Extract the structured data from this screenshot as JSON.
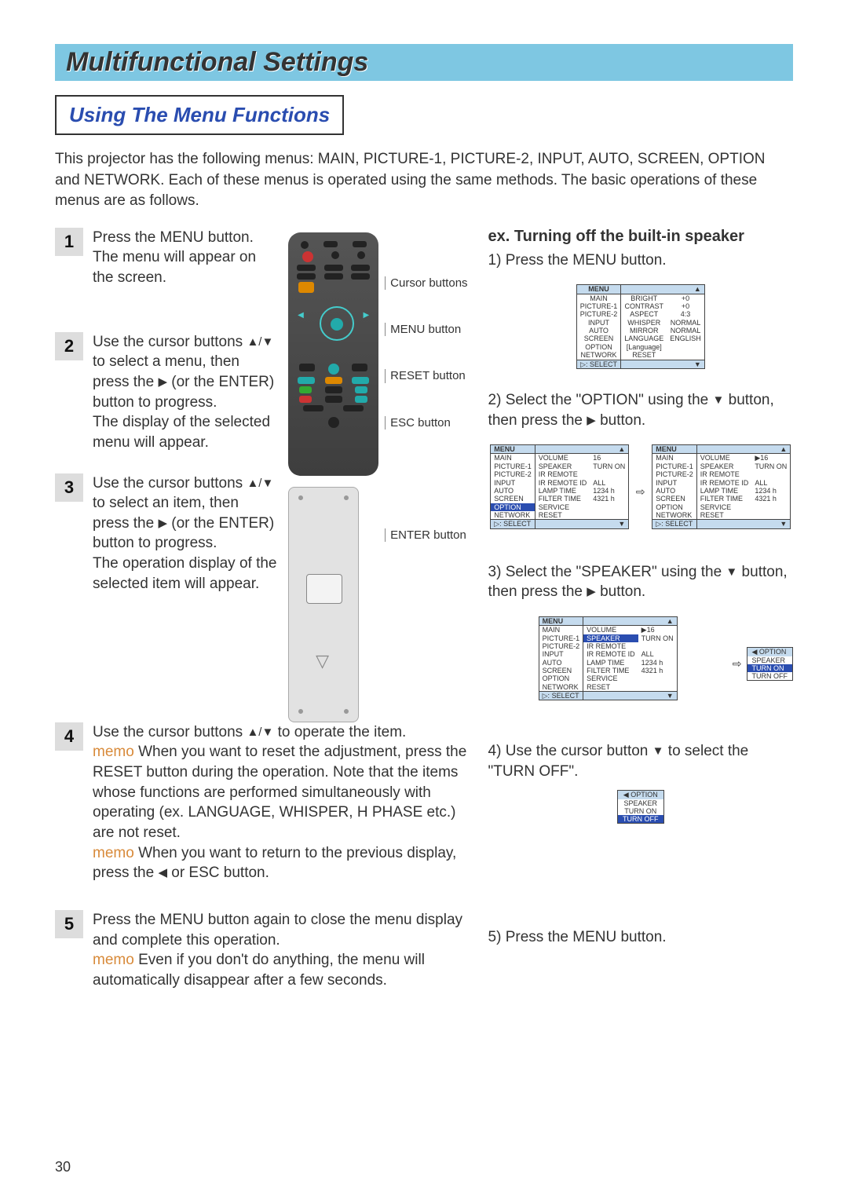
{
  "title": "Multifunctional Settings",
  "subtitle": "Using The Menu Functions",
  "intro": "This projector has the following menus: MAIN, PICTURE-1, PICTURE-2, INPUT, AUTO, SCREEN, OPTION and NETWORK. Each of these menus is operated using the same methods. The basic operations of these menus are as follows.",
  "steps": {
    "s1": {
      "num": "1",
      "text": "Press the MENU button. The menu will appear on the screen."
    },
    "s2": {
      "num": "2",
      "text_a": "Use the cursor buttons ",
      "text_b": " to select a menu, then press the ",
      "text_c": " (or the ENTER) button to progress.",
      "text_d": "The display of the selected menu will appear."
    },
    "s3": {
      "num": "3",
      "text_a": "Use the cursor buttons ",
      "text_b": " to select an item, then press the ",
      "text_c": " (or the ENTER) button to progress.",
      "text_d": "The operation display of the selected item will appear."
    },
    "s4": {
      "num": "4",
      "heading_a": "Use the cursor buttons ",
      "heading_b": " to operate the item.",
      "memo1": "memo",
      "note1": " When you want to reset the adjustment, press the RESET button during the operation. Note that the items whose functions are performed simultaneously with operating (ex. LANGUAGE, WHISPER, H PHASE etc.) are not reset.",
      "memo2": "memo",
      "note2_a": " When you want to return to the previous display, press the ",
      "note2_b": " or ESC button."
    },
    "s5": {
      "num": "5",
      "text": "Press the MENU button again to close the menu display and complete this operation.",
      "memo": "memo",
      "note": " Even if you don't do anything, the menu will automatically disappear after a few seconds."
    }
  },
  "remote_labels": {
    "cursor": "Cursor buttons",
    "menu": "MENU button",
    "reset": "RESET button",
    "esc": "ESC button",
    "enter": "ENTER button"
  },
  "example": {
    "title": "ex. Turning off the built-in speaker",
    "s1": "1) Press the MENU button.",
    "s2_a": "2) Select the \"OPTION\" using the ",
    "s2_b": " button, then press the ",
    "s2_c": " button.",
    "s3_a": "3) Select the \"SPEAKER\" using the ",
    "s3_b": " button, then press the ",
    "s3_c": " button.",
    "s4_a": "4) Use the cursor button ",
    "s4_b": " to select the \"TURN OFF\".",
    "s5": "5) Press the MENU button."
  },
  "osd_main": {
    "header": "MENU",
    "rows": [
      [
        "MAIN",
        "BRIGHT",
        "+0"
      ],
      [
        "PICTURE-1",
        "CONTRAST",
        "+0"
      ],
      [
        "PICTURE-2",
        "ASPECT",
        "4:3"
      ],
      [
        "INPUT",
        "WHISPER",
        "NORMAL"
      ],
      [
        "AUTO",
        "MIRROR",
        "NORMAL"
      ],
      [
        "SCREEN",
        "LANGUAGE",
        "ENGLISH"
      ],
      [
        "OPTION",
        "[Language]",
        ""
      ],
      [
        "NETWORK",
        "RESET",
        ""
      ]
    ],
    "footer": "▷: SELECT"
  },
  "osd_option_a": {
    "header": "MENU",
    "rows": [
      [
        "MAIN",
        "VOLUME",
        "16"
      ],
      [
        "PICTURE-1",
        "SPEAKER",
        "TURN ON"
      ],
      [
        "PICTURE-2",
        "IR REMOTE",
        ""
      ],
      [
        "INPUT",
        "IR REMOTE ID",
        "ALL"
      ],
      [
        "AUTO",
        "LAMP TIME",
        "1234 h"
      ],
      [
        "SCREEN",
        "FILTER TIME",
        "4321 h"
      ],
      [
        "OPTION",
        "SERVICE",
        ""
      ],
      [
        "NETWORK",
        "RESET",
        ""
      ]
    ],
    "footer": "▷: SELECT",
    "hl_left": "OPTION"
  },
  "osd_option_b": {
    "header": "MENU",
    "rows": [
      [
        "MAIN",
        "VOLUME",
        "▶16"
      ],
      [
        "PICTURE-1",
        "SPEAKER",
        "TURN ON"
      ],
      [
        "PICTURE-2",
        "IR REMOTE",
        ""
      ],
      [
        "INPUT",
        "IR REMOTE ID",
        "ALL"
      ],
      [
        "AUTO",
        "LAMP TIME",
        "1234 h"
      ],
      [
        "SCREEN",
        "FILTER TIME",
        "4321 h"
      ],
      [
        "OPTION",
        "SERVICE",
        ""
      ],
      [
        "NETWORK",
        "RESET",
        ""
      ]
    ],
    "footer": "▷: SELECT"
  },
  "osd_speaker": {
    "header": "MENU",
    "rows": [
      [
        "MAIN",
        "VOLUME",
        "▶16"
      ],
      [
        "PICTURE-1",
        "SPEAKER",
        "TURN ON"
      ],
      [
        "PICTURE-2",
        "IR REMOTE",
        ""
      ],
      [
        "INPUT",
        "IR REMOTE ID",
        "ALL"
      ],
      [
        "AUTO",
        "LAMP TIME",
        "1234 h"
      ],
      [
        "SCREEN",
        "FILTER TIME",
        "4321 h"
      ],
      [
        "OPTION",
        "SERVICE",
        ""
      ],
      [
        "NETWORK",
        "RESET",
        ""
      ]
    ],
    "footer": "▷: SELECT",
    "hl_mid": "SPEAKER",
    "pop": [
      "◀ OPTION",
      "SPEAKER",
      "TURN ON",
      "TURN OFF"
    ],
    "pop_hl": "TURN ON"
  },
  "osd_turnoff": {
    "rows": [
      "◀ OPTION",
      "SPEAKER",
      "TURN ON",
      "TURN OFF"
    ],
    "hl": "TURN OFF"
  },
  "arrows": {
    "ud": "▲/▼",
    "r": "▶",
    "d": "▼",
    "l": "◀",
    "rarr": "⇨"
  },
  "page_number": "30"
}
